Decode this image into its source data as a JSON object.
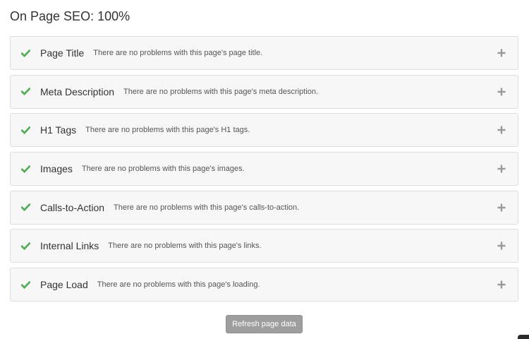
{
  "heading": "On Page SEO: 100%",
  "checks": [
    {
      "title": "Page Title",
      "description": "There are no problems with this page's page title.",
      "status": "pass"
    },
    {
      "title": "Meta Description",
      "description": "There are no problems with this page's meta description.",
      "status": "pass"
    },
    {
      "title": "H1 Tags",
      "description": "There are no problems with this page's H1 tags.",
      "status": "pass"
    },
    {
      "title": "Images",
      "description": "There are no problems with this page's images.",
      "status": "pass"
    },
    {
      "title": "Calls-to-Action",
      "description": "There are no problems with this page's calls-to-action.",
      "status": "pass"
    },
    {
      "title": "Internal Links",
      "description": "There are no problems with this page's links.",
      "status": "pass"
    },
    {
      "title": "Page Load",
      "description": "There are no problems with this page's loading.",
      "status": "pass"
    }
  ],
  "icons": {
    "status": "checkmark-icon",
    "expand": "plus-icon"
  },
  "colors": {
    "check_green": "#4caf50",
    "card_bg": "#f7f7f7",
    "card_border": "#dedede",
    "button_bg": "#9e9e9e"
  },
  "refresh_button_label": "Refresh page data"
}
